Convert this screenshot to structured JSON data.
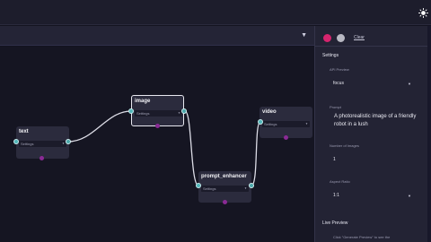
{
  "toolbar": {
    "dropdown_icon": "chevron-down-icon"
  },
  "header": {
    "theme_icon": "sun-icon"
  },
  "nodes": {
    "text": {
      "title": "text",
      "settings_label": "Settings"
    },
    "image": {
      "title": "image",
      "settings_label": "Settings"
    },
    "prompt_enhancer": {
      "title": "prompt_enhancer",
      "settings_label": "Settings"
    },
    "video": {
      "title": "video",
      "settings_label": "Settings"
    }
  },
  "colors": {
    "port": "#50b5b8",
    "port_dot": "#8a2a95",
    "swatch_primary": "#d6246e",
    "swatch_secondary": "#b8b8c2",
    "edge": "#dcdce6"
  },
  "panel": {
    "clear_label": "Clear",
    "settings_title": "Settings",
    "api_preview": {
      "label": "API Preview",
      "value": "focus"
    },
    "prompt": {
      "label": "Prompt",
      "value": "A photorealistic image of a friendly robot in a lush"
    },
    "number_of_images": {
      "label": "Number of Images",
      "value": "1"
    },
    "aspect_ratio": {
      "label": "Aspect Ratio",
      "value": "1:1"
    },
    "live_preview_title": "Live Preview",
    "live_preview_hint": "Click \"Generate Preview\" to see the"
  }
}
